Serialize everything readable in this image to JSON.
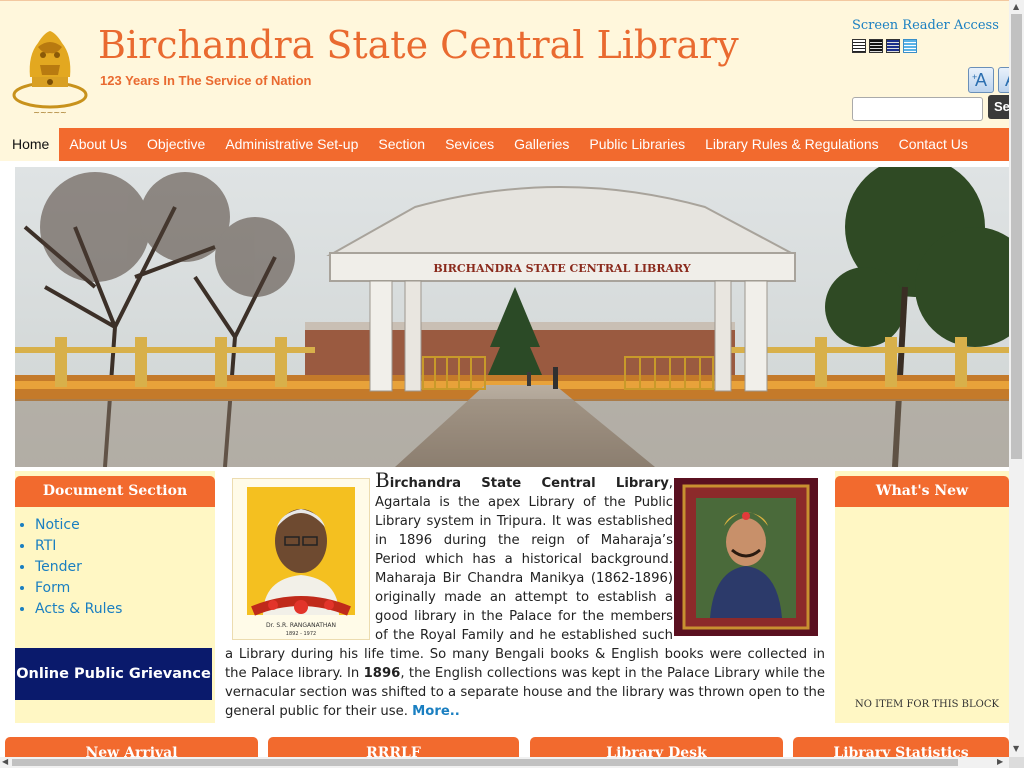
{
  "header": {
    "title": "Birchandra State Central Library",
    "tagline": "123 Years In The Service of Nation",
    "screen_reader": "Screen Reader Access",
    "font_increase": "A",
    "font_decrease": "A",
    "search_button": "Se",
    "emblem_icon": "national-emblem-icon"
  },
  "nav": {
    "items": [
      "Home",
      "About Us",
      "Objective",
      "Administrative Set-up",
      "Section",
      "Sevices",
      "Galleries",
      "Public Libraries",
      "Library Rules & Regulations",
      "Contact Us"
    ]
  },
  "banner": {
    "sign_text": "BIRCHANDRA STATE CENTRAL LIBRARY"
  },
  "document_section": {
    "heading": "Document Section",
    "items": [
      "Notice",
      "RTI",
      "Tender",
      "Form",
      "Acts & Rules"
    ],
    "grievance": "Online Public Grievance"
  },
  "about": {
    "lead_letter": "B",
    "lead_bold": "irchandra State Central Library",
    "text_1": ", Agartala is the apex Library of the Public Library system in Tripura. It was established in 1896 during the reign of Maharaja’s Period which has a historical background. Maharaja Bir Chandra Manikya (1862-1896) originally made an attempt to establish a good library in the Palace for the members of the Royal Family and he established such a Library during his life time. So many Bengali books & English books were collected in the Palace library. In ",
    "year_bold": "1896",
    "text_2": ", the English collections was kept in the Palace Library while the vernacular section was shifted to a separate house and the library was thrown open to the general public for their use. ",
    "more": "More..",
    "portrait_caption": "Dr. S.R. RANGANATHAN",
    "portrait_years": "1892 - 1972"
  },
  "whats_new": {
    "heading": "What's New",
    "empty": "NO ITEM FOR THIS BLOCK"
  },
  "bottom_tabs": [
    "New Arrival",
    "RRRLF",
    "Library Desk",
    "Library Statistics"
  ],
  "colors": {
    "accent": "#f26a2e",
    "header_bg": "#fff7dc",
    "panel_bg": "#fff7c4",
    "link": "#1a7fc1",
    "grievance_bg": "#0a1a6c"
  }
}
